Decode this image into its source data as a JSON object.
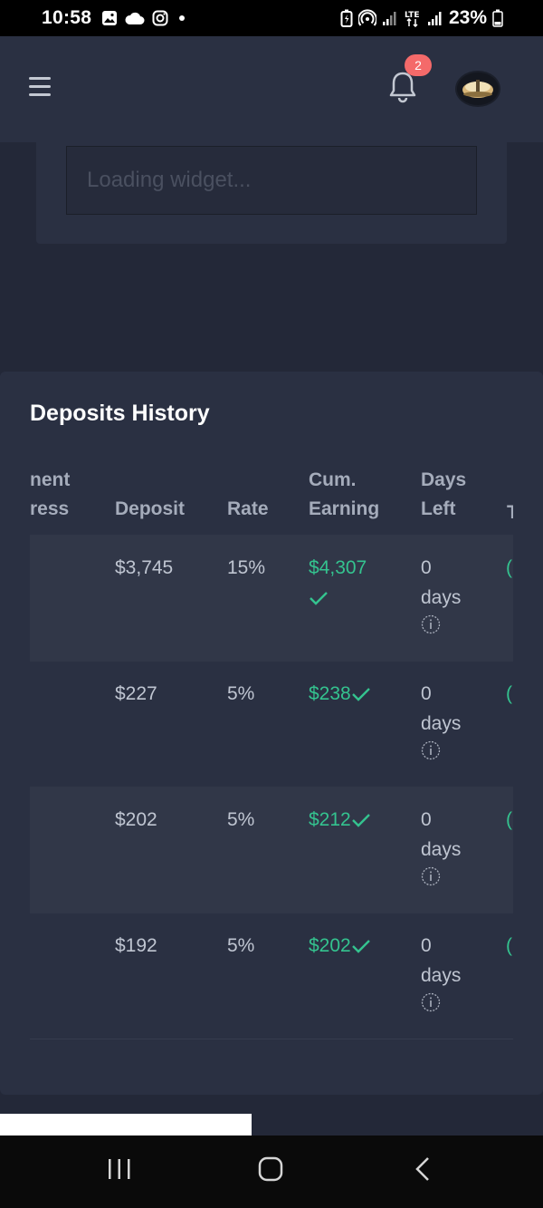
{
  "status_bar": {
    "time": "10:58",
    "battery": "23%",
    "icons": [
      "gallery-icon",
      "cloud-icon",
      "instagram-icon",
      "dot-icon",
      "battery-saver-icon",
      "hotspot-icon",
      "signal-icon",
      "lte-icon",
      "signal-icon",
      "battery-icon"
    ]
  },
  "header": {
    "menu_icon": "hamburger-icon",
    "notification_icon": "bell-icon",
    "notification_count": "2",
    "avatar_icon": "avatar"
  },
  "top_widget": {
    "placeholder": "Loading widget..."
  },
  "deposits": {
    "title": "Deposits History",
    "columns": {
      "address_line1": "nent",
      "address_line2": "ress",
      "deposit": "Deposit",
      "rate": "Rate",
      "earning_line1": "Cum.",
      "earning_line2": "Earning",
      "days_line1": "Days",
      "days_line2": "Left",
      "edge": "T"
    },
    "rows": [
      {
        "deposit": "$3,745",
        "rate": "15%",
        "earning": "$4,307",
        "days": "0",
        "days_unit": "days",
        "edge": "("
      },
      {
        "deposit": "$227",
        "rate": "5%",
        "earning": "$238",
        "days": "0",
        "days_unit": "days",
        "edge": "("
      },
      {
        "deposit": "$202",
        "rate": "5%",
        "earning": "$212",
        "days": "0",
        "days_unit": "days",
        "edge": "("
      },
      {
        "deposit": "$192",
        "rate": "5%",
        "earning": "$202",
        "days": "0",
        "days_unit": "days",
        "edge": "("
      }
    ]
  },
  "colors": {
    "background": "#232838",
    "card": "#2a3042",
    "accent_green": "#34c38f",
    "badge_red": "#f46a6a"
  },
  "nav_bar": {
    "icons": [
      "recents-icon",
      "home-icon",
      "back-icon"
    ]
  }
}
